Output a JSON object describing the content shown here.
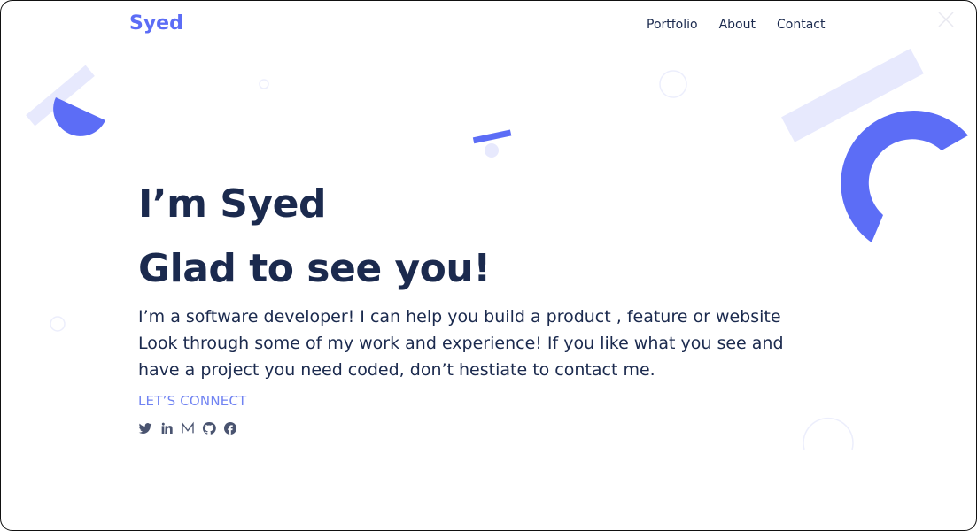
{
  "brand": {
    "logo": "Syed"
  },
  "nav": {
    "portfolio": "Portfolio",
    "about": "About",
    "contact": "Contact"
  },
  "hero": {
    "line1": "I’m Syed",
    "line2": "Glad to see you!",
    "intro": "I’m a software developer! I can help you build a product , feature or website Look through some of my work and experience! If you like what you see and have a project you need coded, don’t hestiate to contact me.",
    "cta": "LET’S CONNECT"
  },
  "socials": [
    "twitter-icon",
    "linkedin-icon",
    "medium-icon",
    "github-icon",
    "facebook-icon"
  ],
  "colors": {
    "accent": "#5c6df6",
    "accent_light": "#e7e9fd",
    "text": "#1b2a4e",
    "link": "#7083f2"
  }
}
